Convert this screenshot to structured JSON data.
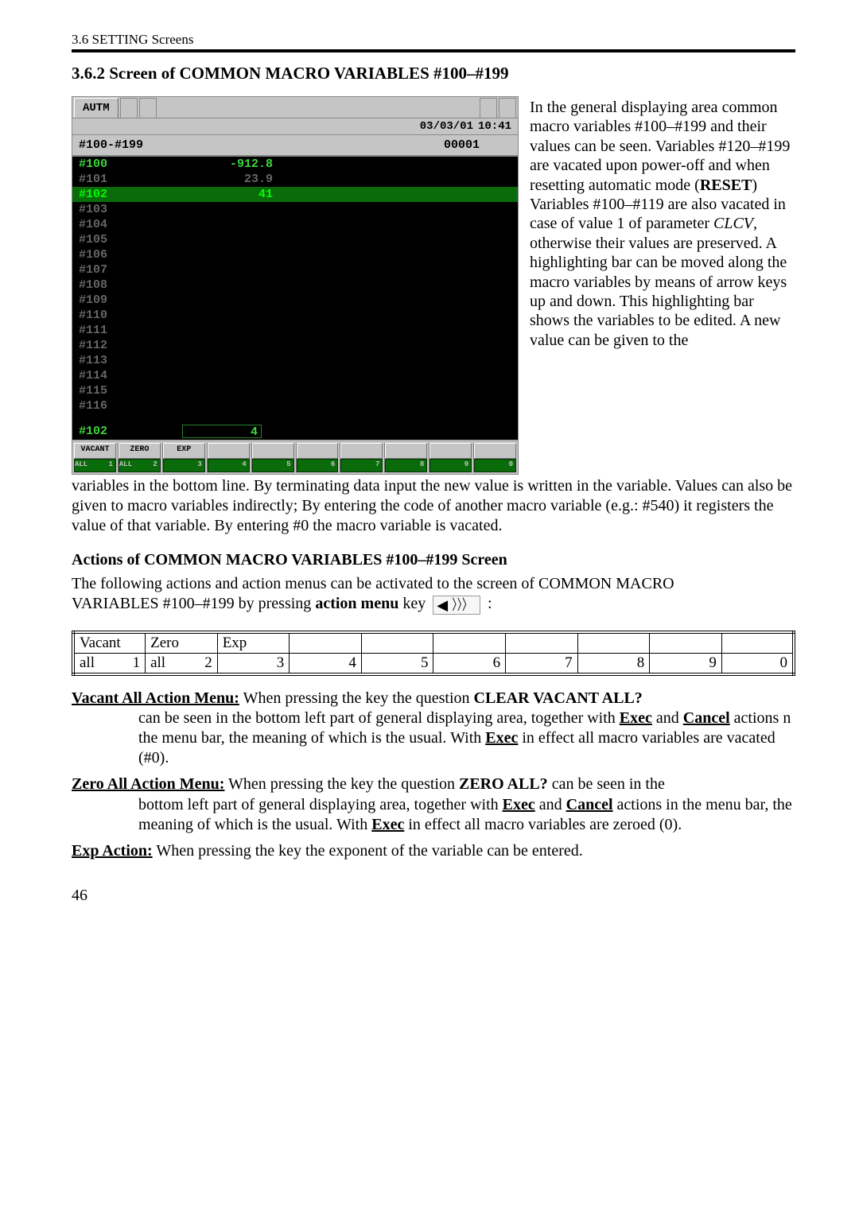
{
  "header": {
    "breadcrumb": "3.6 SETTING Screens"
  },
  "section": {
    "title": "3.6.2 Screen of COMMON MACRO VARIABLES #100–#199"
  },
  "screen": {
    "tab_label": "AUTM",
    "datetime_date": "03/03/01",
    "datetime_time": "10:41",
    "col_left": "#100-#199",
    "col_right": "00001",
    "rows": [
      {
        "id": "#100",
        "val": "-912.8",
        "muted": false
      },
      {
        "id": "#101",
        "val": "23.9",
        "muted": true
      },
      {
        "id": "#102",
        "val": "41",
        "muted": false,
        "highlight": true
      },
      {
        "id": "#103",
        "val": "",
        "muted": true
      },
      {
        "id": "#104",
        "val": "",
        "muted": true
      },
      {
        "id": "#105",
        "val": "",
        "muted": true
      },
      {
        "id": "#106",
        "val": "",
        "muted": true
      },
      {
        "id": "#107",
        "val": "",
        "muted": true
      },
      {
        "id": "#108",
        "val": "",
        "muted": true
      },
      {
        "id": "#109",
        "val": "",
        "muted": true
      },
      {
        "id": "#110",
        "val": "",
        "muted": true
      },
      {
        "id": "#111",
        "val": "",
        "muted": true
      },
      {
        "id": "#112",
        "val": "",
        "muted": true
      },
      {
        "id": "#113",
        "val": "",
        "muted": true
      },
      {
        "id": "#114",
        "val": "",
        "muted": true
      },
      {
        "id": "#115",
        "val": "",
        "muted": true
      },
      {
        "id": "#116",
        "val": "",
        "muted": true
      }
    ],
    "input_label": "#102",
    "input_value": "4",
    "softkeys": [
      {
        "top": "VACANT",
        "bot": "ALL",
        "n": "1"
      },
      {
        "top": "ZERO",
        "bot": "ALL",
        "n": "2"
      },
      {
        "top": "EXP",
        "bot": "",
        "n": "3"
      },
      {
        "top": "",
        "bot": "",
        "n": "4"
      },
      {
        "top": "",
        "bot": "",
        "n": "5"
      },
      {
        "top": "",
        "bot": "",
        "n": "6"
      },
      {
        "top": "",
        "bot": "",
        "n": "7"
      },
      {
        "top": "",
        "bot": "",
        "n": "8"
      },
      {
        "top": "",
        "bot": "",
        "n": "9"
      },
      {
        "top": "",
        "bot": "",
        "n": "0"
      }
    ]
  },
  "right_para": "In the general displaying area common macro variables #100–#199 and their values can be seen. Variables #120–#199 are vacated upon power-off and when resetting automatic mode (RESET) Variables #100–#119 are also vacated in case of value 1 of parameter CLCV, otherwise their values are preserved. A highlighting bar can be moved along the macro variables by means of arrow keys up and down. This highlighting bar shows the variables to be edited. A new value can be given to the",
  "body_para": "variables in the bottom line. By terminating data input the new value is written in the variable. Values can also be given to macro variables indirectly; By entering the code of another macro variable (e.g.: #540) it registers the value of that variable. By entering #0 the macro variable is vacated.",
  "actions_head": "Actions of COMMON MACRO VARIABLES #100–#199 Screen",
  "actions_intro_1": "The following actions and action menus can be activated to the screen of COMMON MACRO",
  "actions_intro_2a": "VARIABLES #100–#199 by pressing ",
  "actions_intro_2b": "action menu",
  "actions_intro_2c": " key ",
  "actions_intro_2d": " :",
  "menu_table": {
    "row1": [
      "Vacant",
      "Zero",
      "Exp",
      "",
      "",
      "",
      "",
      "",
      "",
      ""
    ],
    "row2_labels": [
      "all",
      "all"
    ],
    "row2_nums": [
      "1",
      "2",
      "3",
      "4",
      "5",
      "6",
      "7",
      "8",
      "9",
      "0"
    ]
  },
  "defs": {
    "vac_title": "Vacant All Action Menu:",
    "vac_first": " When pressing the key the question CLEAR VACANT ALL?",
    "vac_rest": "can be seen in the bottom left part of general displaying area, together with <b><u>Exec</u></b> and <b><u>Cancel</u></b> actions n the menu bar, the meaning of which is the usual. With <b><u>Exec</u></b> in effect all macro variables are vacated (#0).",
    "zero_title": "Zero All Action Menu:",
    "zero_first": " When pressing the key the question ZERO ALL? can be seen in the",
    "zero_rest": "bottom left part of general displaying area, together with <b><u>Exec</u></b> and <b><u>Cancel</u></b> actions in the menu bar, the meaning of which is the usual. With <b><u>Exec</u></b> in effect all macro variables are zeroed (0).",
    "exp_title": "Exp Action:",
    "exp_first": " When pressing the key the exponent of the variable can be entered."
  },
  "page_number": "46"
}
